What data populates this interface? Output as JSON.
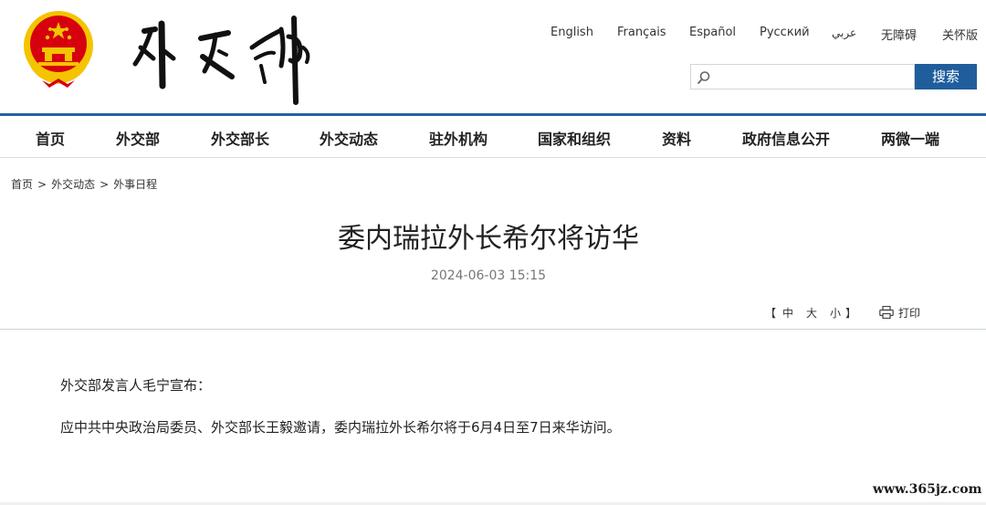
{
  "header": {
    "languages": [
      "English",
      "Français",
      "Español",
      "Русский",
      "عربي",
      "无障碍",
      "关怀版"
    ],
    "search": {
      "value": "",
      "placeholder": "",
      "button_label": "搜索"
    },
    "colors": {
      "brand_blue": "#1f5d9c",
      "nav_rule": "#24629f",
      "emblem_red": "#d7000f",
      "emblem_gold": "#f4c400"
    },
    "icons": {
      "search": "search-icon",
      "emblem": "national-emblem-icon"
    }
  },
  "nav": {
    "items": [
      "首页",
      "外交部",
      "外交部长",
      "外交动态",
      "驻外机构",
      "国家和组织",
      "资料",
      "政府信息公开",
      "两微一端"
    ]
  },
  "breadcrumb": {
    "items": [
      "首页",
      "外交动态",
      "外事日程"
    ],
    "separator": ">"
  },
  "article": {
    "title": "委内瑞拉外长希尔将访华",
    "date": "2024-06-03 15:15",
    "font_size_controls": {
      "open": "【",
      "small": "中",
      "medium": "大",
      "large": "小",
      "close": "】"
    },
    "print_label": "打印",
    "paragraphs": [
      "外交部发言人毛宁宣布：",
      "应中共中央政治局委员、外交部长王毅邀请，委内瑞拉外长希尔将于6月4日至7日来华访问。"
    ]
  },
  "watermark": "www.365jz.com"
}
